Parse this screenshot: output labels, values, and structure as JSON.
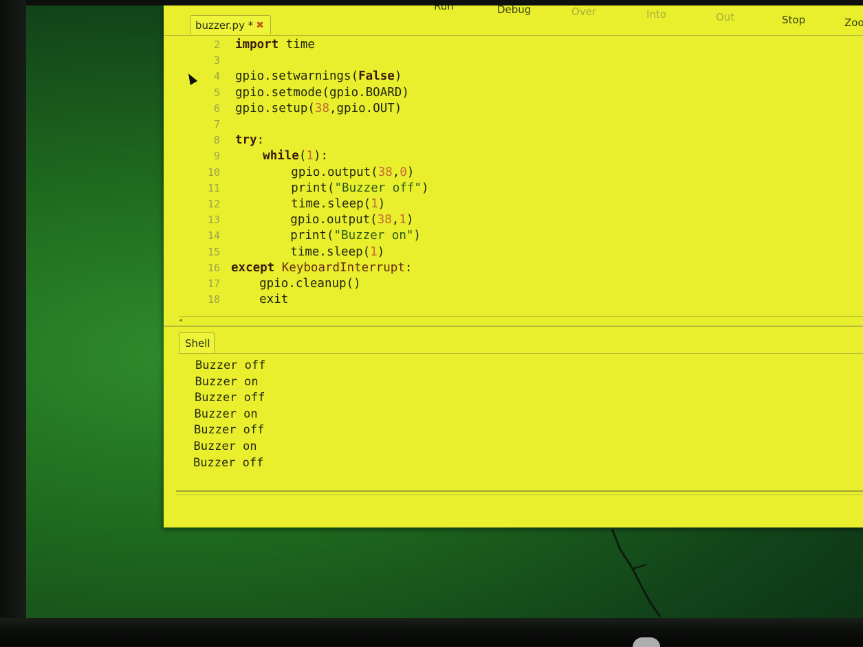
{
  "toolbar": {
    "run": "Run",
    "debug": "Debug",
    "over": "Over",
    "into": "Into",
    "out": "Out",
    "stop": "Stop",
    "zoom": "Zoo"
  },
  "editor": {
    "tab_label": "buzzer.py *",
    "tab_close": "✖",
    "line_numbers": [
      "2",
      "3",
      "4",
      "5",
      "6",
      "7",
      "8",
      "9",
      "10",
      "11",
      "12",
      "13",
      "14",
      "15",
      "16",
      "17",
      "18"
    ],
    "lines": [
      {
        "t": "import time"
      },
      {
        "t": ""
      },
      {
        "t": "gpio.setwarnings(False)"
      },
      {
        "t": "gpio.setmode(gpio.BOARD)"
      },
      {
        "t": "gpio.setup(38,gpio.OUT)"
      },
      {
        "t": ""
      },
      {
        "t": "try:"
      },
      {
        "t": "    while(1):"
      },
      {
        "t": "        gpio.output(38,0)"
      },
      {
        "t": "        print(\"Buzzer off\")"
      },
      {
        "t": "        time.sleep(1)"
      },
      {
        "t": "        gpio.output(38,1)"
      },
      {
        "t": "        print(\"Buzzer on\")"
      },
      {
        "t": "        time.sleep(1)"
      },
      {
        "t": "except KeyboardInterrupt:"
      },
      {
        "t": "    gpio.cleanup()"
      },
      {
        "t": "    exit"
      }
    ]
  },
  "shell": {
    "tab_label": "Shell",
    "output": [
      "Buzzer off",
      "Buzzer on",
      "Buzzer off",
      "Buzzer on",
      "Buzzer off",
      "Buzzer on",
      "Buzzer off"
    ]
  },
  "colors": {
    "window_bg": "#e9ef2c",
    "keyword": "#3a1b0e",
    "number": "#c56a35",
    "string": "#2c5a1a"
  }
}
